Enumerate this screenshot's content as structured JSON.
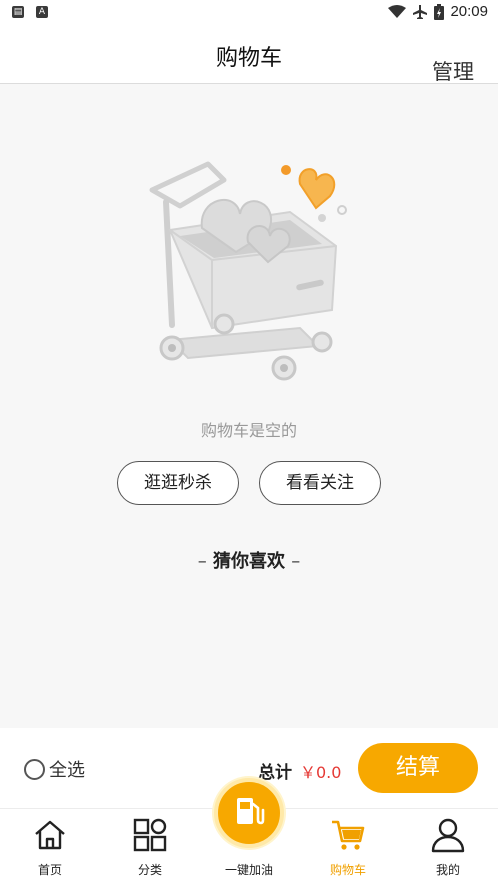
{
  "status_bar": {
    "time": "20:09",
    "left_icons": [
      "notification-icon",
      "a-letter-icon"
    ],
    "right_icons": [
      "wifi-icon",
      "airplane-icon",
      "battery-charging-icon"
    ]
  },
  "header": {
    "title": "购物车",
    "manage_label": "管理"
  },
  "empty_state": {
    "message": "购物车是空的",
    "seckill_button": "逛逛秒杀",
    "follow_button": "看看关注",
    "illustration": "shopping-cart-with-hearts-illustration"
  },
  "guess": {
    "dash_left": "–",
    "title": "猜你喜欢",
    "dash_right": "–"
  },
  "checkout": {
    "select_all_label": "全选",
    "total_label": "总计",
    "total_value": "￥0.0",
    "checkout_button": "结算"
  },
  "tabbar": {
    "items": [
      {
        "label": "首页",
        "icon": "home-icon",
        "active": false
      },
      {
        "label": "分类",
        "icon": "category-grid-icon",
        "active": false
      },
      {
        "label": "一键加油",
        "icon": "fuel-pump-icon",
        "active": false
      },
      {
        "label": "购物车",
        "icon": "cart-icon",
        "active": true
      },
      {
        "label": "我的",
        "icon": "user-icon",
        "active": false
      }
    ]
  },
  "colors": {
    "accent": "#f7a800",
    "active_tab": "#f0a000",
    "price": "#e53935",
    "background": "#f7f7f7"
  }
}
